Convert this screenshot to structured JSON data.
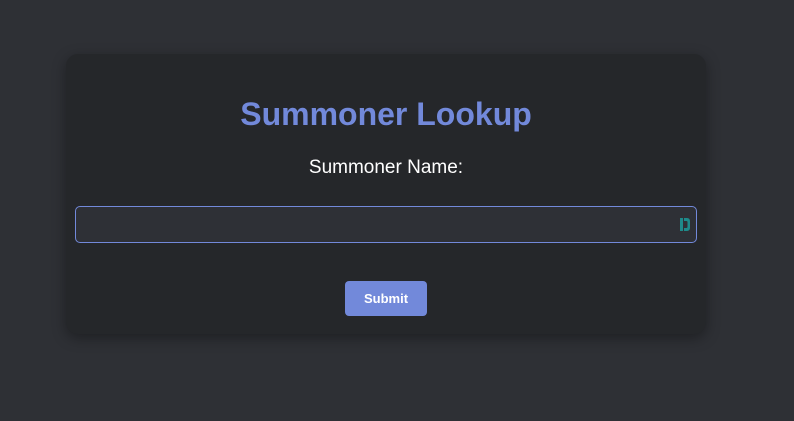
{
  "form": {
    "title": "Summoner Lookup",
    "label": "Summoner Name:",
    "input_value": "",
    "input_placeholder": "",
    "submit_label": "Submit"
  },
  "colors": {
    "accent": "#7289da",
    "page_background": "#2e3035",
    "card_background": "#25272a",
    "input_background": "#2e3036",
    "extension_icon": "#1e8a8a"
  },
  "icons": {
    "input_extension": "password-manager-icon"
  }
}
